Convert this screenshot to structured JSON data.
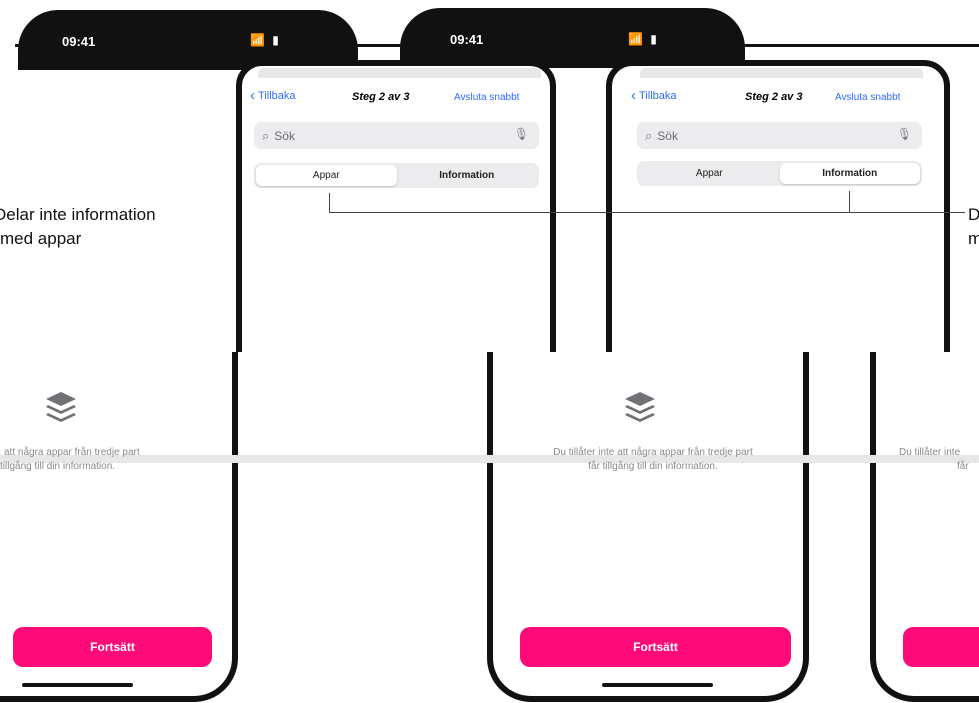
{
  "status": {
    "time": "09:41",
    "icons": "📶 ▮"
  },
  "nav": {
    "back_label": "Tillbaka",
    "step_label": "Steg 2 av 3",
    "exit_label": "Avsluta snabbt"
  },
  "search": {
    "placeholder": "Sök"
  },
  "segments": [
    "Appar",
    "Information"
  ],
  "callouts": {
    "left": [
      "Delar inte information",
      "med appar"
    ],
    "right": [
      "D",
      "m"
    ]
  },
  "empty_state": {
    "line1": "Du tillåter inte att några appar från tredje part",
    "line2": "får tillgång till din information.",
    "left_line1": "att några appar från tredje part",
    "left_line2": "tillgång till din information.",
    "right_line1": "Du tillåter inte",
    "right_line2": "får"
  },
  "cta": {
    "label": "Fortsätt"
  },
  "icons": {
    "back": "chevron-left-icon",
    "search": "search-icon",
    "mic": "microphone-icon",
    "layers": "layers-icon"
  },
  "colors": {
    "accent": "#ff0a78",
    "link": "#2f6bff"
  }
}
